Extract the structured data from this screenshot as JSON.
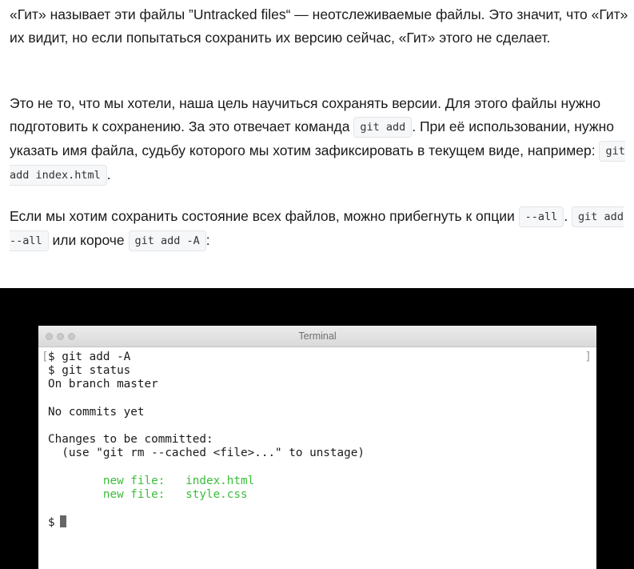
{
  "article": {
    "p1": {
      "t1": "«Гит» называет эти файлы ”Untracked files“ — неотслеживаемые файлы. Это значит, что «Гит» их видит, но если попытаться сохранить их версию сейчас, «Гит» этого не сделает."
    },
    "p2": {
      "t1": "Это не то, что мы хотели, наша цель научиться сохранять версии. Для этого файлы нужно подготовить к сохранению. За это отвечает команда ",
      "c1": "git add",
      "t2": ". При её использовании, нужно указать имя файла, судьбу которого мы хотим зафиксировать в текущем виде, например: ",
      "c2": "git add index.html",
      "t3": "."
    },
    "p3": {
      "t1": "Если мы хотим сохранить состояние всех файлов, можно прибегнуть к опции ",
      "c1": "--all",
      "t2": ". ",
      "c2": "git add --all",
      "t3": " или короче ",
      "c3": "git add -A",
      "t4": ":"
    }
  },
  "terminal": {
    "title": "Terminal",
    "lines": {
      "l1": "$ git add -A",
      "l2": "$ git status",
      "l3": "On branch master",
      "l4": "No commits yet",
      "l5": "Changes to be committed:",
      "l6": "  (use \"git rm --cached <file>...\" to unstage)",
      "l7": "        new file:   index.html",
      "l8": "        new file:   style.css",
      "prompt": "$"
    }
  }
}
